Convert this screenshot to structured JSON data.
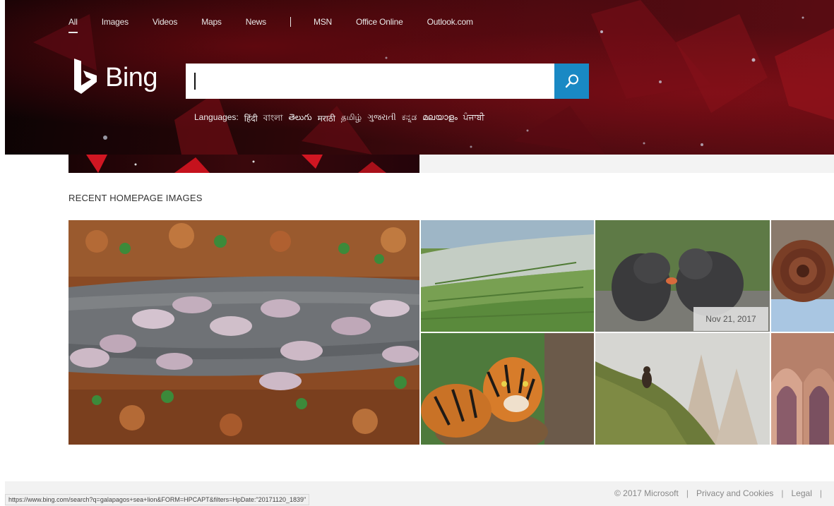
{
  "nav": {
    "items": [
      "All",
      "Images",
      "Videos",
      "Maps",
      "News"
    ],
    "external": [
      "MSN",
      "Office Online",
      "Outlook.com"
    ]
  },
  "brand": {
    "name": "Bing"
  },
  "search": {
    "value": "",
    "placeholder": ""
  },
  "languages": {
    "label": "Languages:",
    "items": [
      "हिंदी",
      "বাংলা",
      "తెలుగు",
      "मराठी",
      "தமிழ்",
      "ગુજરાતી",
      "ಕನ್ನಡ",
      "മലയാളം",
      "ਪੰਜਾਬੀ"
    ]
  },
  "section": {
    "title": "RECENT HOMEPAGE IMAGES"
  },
  "gallery": {
    "date_badge": "Nov 21, 2017"
  },
  "status_bar": {
    "url": "https://www.bing.com/search?q=galapagos+sea+lion&FORM=HPCAPT&filters=HpDate:\"20171120_1839\""
  },
  "footer": {
    "copyright": "© 2017 Microsoft",
    "privacy": "Privacy and Cookies",
    "legal": "Legal"
  },
  "colors": {
    "accent": "#1989c4",
    "hero": "#3a070b"
  }
}
